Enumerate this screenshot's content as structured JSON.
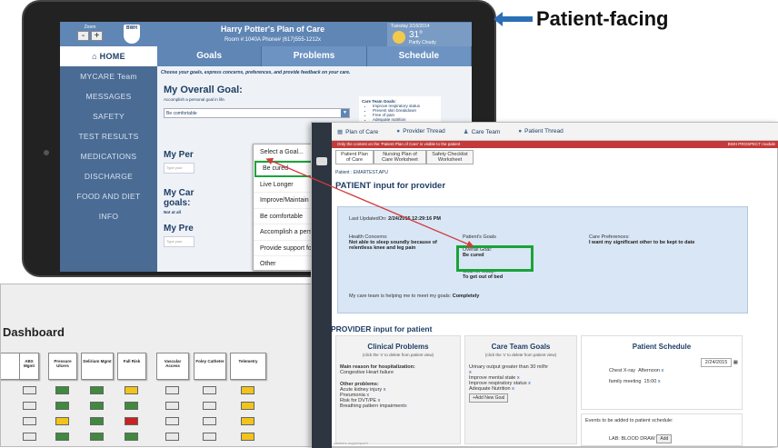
{
  "tablet": {
    "zoom_label": "Zoom",
    "zoom_minus": "-",
    "zoom_plus": "+",
    "logo_text": "BWH",
    "title": "Harry Potter's Plan of Care",
    "subtitle": "Room #:1040A  Phone# (617)555-1212x",
    "weather_date": "Tuesday 2/16/2014",
    "weather_temp": "31°",
    "weather_cond": "Partly Cloudy",
    "nav": [
      "HOME",
      "MYCARE Team",
      "MESSAGES",
      "SAFETY",
      "TEST RESULTS",
      "MEDICATIONS",
      "DISCHARGE",
      "FOOD AND DIET",
      "INFO"
    ],
    "tabs": [
      "Goals",
      "Problems",
      "Schedule"
    ],
    "intro": "Choose your goals, express concerns, preferences, and provide feedback on your care.",
    "overall_goal_title": "My Overall Goal:",
    "overall_goal_sub": "Accomplish a personal goal in life.",
    "overall_goal_value": "Be comfortable",
    "care_team_goals_title": "Care Team Goals:",
    "care_team_goals": [
      "Improve respiratory status",
      "Prevent skin breakdown",
      "Free of pain",
      "Adequate nutrition"
    ],
    "section_per": "My Per",
    "section_car": "My Car",
    "section_car2": "goals:",
    "not_at_all": "Not at all",
    "section_pre": "My Pre",
    "faint_type": "Type your",
    "dropdown_options": [
      "Select a Goal...",
      "Be cured",
      "Live Longer",
      "Improve/Maintain health",
      "Be comfortable",
      "Accomplish a personal life goal",
      "Provide support for family",
      "Other"
    ]
  },
  "callout": {
    "label": "Patient-facing"
  },
  "provider": {
    "toolbar": [
      "Plan of Care",
      "Provider Thread",
      "Care Team",
      "Patient Thread"
    ],
    "red_notice": "Only the content on the 'Patient Plan of Care' is visible to the patient",
    "red_module": "BWH PROSPECT module",
    "tabs": [
      "Patient Plan of Care",
      "Nursing Plan of Care Worksheet",
      "Safety Checklist Worksheet"
    ],
    "patient_line": "Patient : EMARTEST,APU",
    "patient_input_title": "PATIENT input for provider",
    "last_updated_label": "Last UpdatedOn:",
    "last_updated_value": "2/24/2015 12:29:16 PM",
    "health_concerns_label": "Health Concerns:",
    "health_concerns_value": "Not able to sleep soundly because of relentless knee and leg pain",
    "patients_goals_label": "Patient's Goals",
    "overall_goal_label": "Overall Goal:",
    "overall_goal_value": "Be cured",
    "goal_today_label": "Goal for today:",
    "goal_today_value": "To get out of bed",
    "care_prefs_label": "Care Preferences:",
    "care_prefs_value": "I want my significant other to be kept to date",
    "care_team_help_label": "My care team is helping me to meet my goals:",
    "care_team_help_value": "Completely",
    "provider_input_title": "PROVIDER input for patient",
    "clinical_title": "Clinical Problems",
    "clinical_hint": "(click the 'x' to delete from patient view)",
    "main_reason_label": "Main reason for hospitalization:",
    "main_reason_value": "Congestive Heart failure",
    "other_problems_label": "Other problems:",
    "other_problems": [
      "Acute kidney injury",
      "Pneumonia",
      "Risk for DVT/PE",
      "Breathing pattern impairment"
    ],
    "care_goals_title": "Care Team Goals",
    "care_goals_hint": "(click the 'x' to delete from patient view)",
    "care_goals": [
      "Urinary output greater than 30 ml/hr",
      "Improve mental state",
      "Improve respiratory status",
      "Adequate Nutrition"
    ],
    "add_goal_btn": "+Add New Goal",
    "schedule_title": "Patient Schedule",
    "schedule_date": "2/24/2015",
    "schedule_items": [
      {
        "name": "Chest X-ray",
        "time": "Afternoon"
      },
      {
        "name": "family meeting",
        "time": "15:00"
      }
    ],
    "events_label": "Events to be added to patient schedule:",
    "lab_label": "LAB: BLOOD DRAW",
    "add_btn": "Add",
    "footer_url": "partners.org/plc/pocV"
  },
  "dashboard": {
    "title": "Dashboard",
    "headers": [
      "ABX Mgmt",
      "Pressure Ulcers",
      "Delirium Mgmt",
      "Fall Risk",
      "Vascular Access",
      "Foley Catheter",
      "Telemetry"
    ],
    "rows": [
      [
        "e",
        "g",
        "g",
        "y",
        "e",
        "e",
        "y"
      ],
      [
        "e",
        "g",
        "g",
        "g",
        "e",
        "e",
        "y"
      ],
      [
        "e",
        "y",
        "g",
        "r",
        "e",
        "e",
        "y"
      ],
      [
        "e",
        "g",
        "g",
        "g",
        "e",
        "e",
        "y"
      ]
    ]
  },
  "colors": {
    "accent": "#5f86b5",
    "nav": "#4a6b94",
    "highlight": "#1aa33a",
    "red_bar": "#c43a3a"
  }
}
